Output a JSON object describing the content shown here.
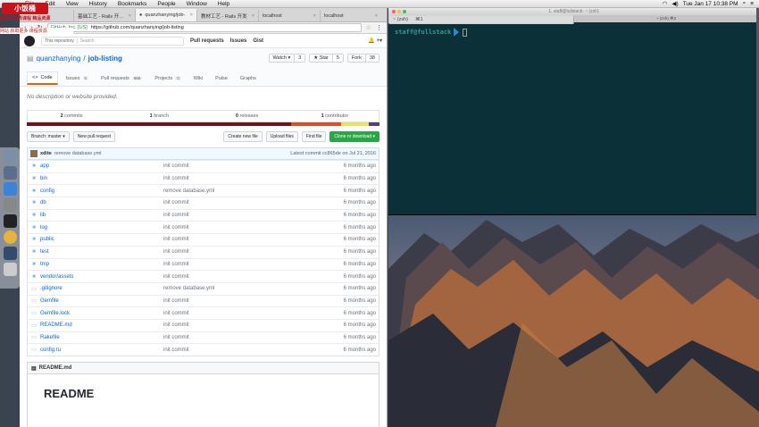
{
  "menubar": {
    "apple": "",
    "app": "File",
    "items": [
      "File",
      "Edit",
      "View",
      "History",
      "Bookmarks",
      "People",
      "Window",
      "Help"
    ],
    "clock": "Tue Jan 17  10:38 PM"
  },
  "badge": {
    "logo": "小饭桶",
    "line1": "国内外优秀课程 精品资源",
    "line2": "网站 获取更多 课程资源"
  },
  "browser": {
    "tabs": [
      {
        "label": "基础工艺 - Rails 开..."
      },
      {
        "label": "quanzhanying/job-"
      },
      {
        "label": "教材工艺 - Rails 开发"
      },
      {
        "label": "localhost"
      },
      {
        "label": "localhost"
      }
    ],
    "address": {
      "secure": "GitHub, Inc. [US]",
      "url": "https://github.com/quanzhanying/job-listing"
    },
    "gh": {
      "scope": "This repository",
      "search": "Search",
      "links": [
        "Pull requests",
        "Issues",
        "Gist"
      ],
      "icons": "🔔  +▾"
    },
    "repo": {
      "owner": "quanzhanying",
      "sep": "/",
      "name": "job-listing",
      "watch": "Watch ▾",
      "watch_count": "3",
      "star": "★ Star",
      "star_count": "5",
      "fork": "Fork",
      "fork_count": "38"
    },
    "nav": [
      {
        "label": "Code",
        "count": ""
      },
      {
        "label": "Issues",
        "count": "0"
      },
      {
        "label": "Pull requests",
        "count": "666"
      },
      {
        "label": "Projects",
        "count": "0"
      },
      {
        "label": "Wiki",
        "count": ""
      },
      {
        "label": "Pulse",
        "count": ""
      },
      {
        "label": "Graphs",
        "count": ""
      }
    ],
    "description": "No description or website provided.",
    "summary": {
      "commits_n": "2",
      "commits": "commits",
      "branch_n": "1",
      "branch": "branch",
      "releases_n": "0",
      "releases": "releases",
      "contrib_n": "1",
      "contrib": "contributor"
    },
    "filebar": {
      "branch": "Branch: master ▾",
      "new_pr": "New pull request",
      "create": "Create new file",
      "upload": "Upload files",
      "find": "Find file",
      "clone": "Clone or download ▾"
    },
    "commit": {
      "author": "xdite",
      "message": "remove database.yml",
      "latest": "Latest commit cc865de on Jul 21, 2016"
    },
    "files": [
      {
        "name": "app",
        "type": "dir",
        "commit": "init commit",
        "age": "6 months ago"
      },
      {
        "name": "bin",
        "type": "dir",
        "commit": "init commit",
        "age": "6 months ago"
      },
      {
        "name": "config",
        "type": "dir",
        "commit": "remove database.yml",
        "age": "6 months ago"
      },
      {
        "name": "db",
        "type": "dir",
        "commit": "init commit",
        "age": "6 months ago"
      },
      {
        "name": "lib",
        "type": "dir",
        "commit": "init commit",
        "age": "6 months ago"
      },
      {
        "name": "log",
        "type": "dir",
        "commit": "init commit",
        "age": "6 months ago"
      },
      {
        "name": "public",
        "type": "dir",
        "commit": "init commit",
        "age": "6 months ago"
      },
      {
        "name": "test",
        "type": "dir",
        "commit": "init commit",
        "age": "6 months ago"
      },
      {
        "name": "tmp",
        "type": "dir",
        "commit": "init commit",
        "age": "6 months ago"
      },
      {
        "name": "vendor/assets",
        "type": "dir",
        "commit": "init commit",
        "age": "6 months ago"
      },
      {
        "name": ".gitignore",
        "type": "file",
        "commit": "remove database.yml",
        "age": "6 months ago"
      },
      {
        "name": "Gemfile",
        "type": "file",
        "commit": "init commit",
        "age": "6 months ago"
      },
      {
        "name": "Gemfile.lock",
        "type": "file",
        "commit": "init commit",
        "age": "6 months ago"
      },
      {
        "name": "README.md",
        "type": "file",
        "commit": "init commit",
        "age": "6 months ago"
      },
      {
        "name": "Rakefile",
        "type": "file",
        "commit": "init commit",
        "age": "6 months ago"
      },
      {
        "name": "config.ru",
        "type": "file",
        "commit": "init commit",
        "age": "6 months ago"
      }
    ],
    "readme": {
      "bar": "README.md",
      "heading": "README"
    }
  },
  "terminal": {
    "title": "1. staff@fullstack: ~ (zsh)",
    "tabs": [
      "~ (zsh)",
      "⌘1",
      "~ (zsh)",
      "⌘2"
    ],
    "prompt": "staff@fullstack"
  }
}
